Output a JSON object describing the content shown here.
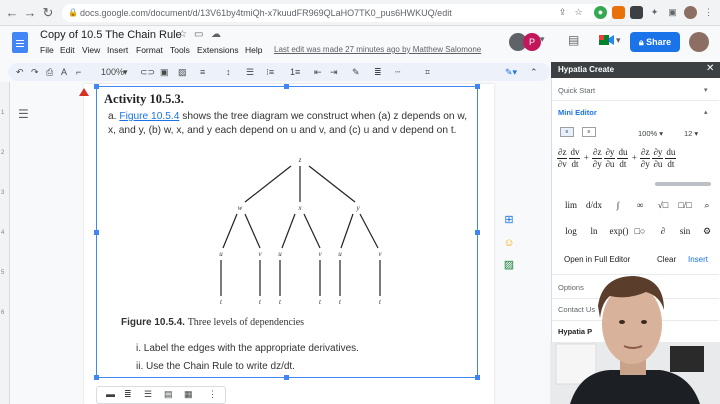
{
  "browser": {
    "url": "docs.google.com/document/d/13V61by4tmiQh-x7kuudFR969QLaHO7TK0_pus6HWKUQ/edit"
  },
  "docs": {
    "title": "Copy of 10.5 The Chain Rule",
    "menu": [
      "File",
      "Edit",
      "View",
      "Insert",
      "Format",
      "Tools",
      "Extensions",
      "Help"
    ],
    "last_edit": "Last edit was made 27 minutes ago by Matthew Salomone",
    "share_label": "Share",
    "avatar_letter": "P"
  },
  "toolbar": {
    "zoom": "100%"
  },
  "ruler": [
    "1",
    "2",
    "3",
    "4",
    "5",
    "6"
  ],
  "document": {
    "activity_title": "Activity 10.5.3.",
    "item_a_label": "a.",
    "figure_link": "Figure 10.5.4",
    "item_a_rest": "shows the tree diagram we construct when (a) z depends on w, x, and y, (b) w, x, and y each depend on u and v, and (c) u and v depend on t.",
    "tree": {
      "root": "z",
      "level1": [
        "w",
        "x",
        "y"
      ],
      "level2": [
        "u",
        "v",
        "u",
        "v",
        "u",
        "v"
      ],
      "level3": [
        "t",
        "t",
        "t",
        "t",
        "t",
        "t"
      ]
    },
    "caption_label": "Figure 10.5.4.",
    "caption_text": "Three levels of dependencies",
    "item_i": "i. Label the edges with the appropriate derivatives.",
    "item_ii": "ii. Use the Chain Rule to write dz/dt."
  },
  "panel": {
    "title": "Hypatia Create",
    "quick_start": "Quick Start",
    "mini_editor": "Mini Editor",
    "zoom": "100%",
    "font_size": "12",
    "symbols_row1": [
      "lim",
      "d/dx",
      "∫",
      "∞",
      "√□",
      "□/□",
      "⌕"
    ],
    "symbols_row2": [
      "log",
      "ln",
      "exp()",
      "□○",
      "∂",
      "sin",
      "⚙"
    ],
    "open_full": "Open in Full Editor",
    "clear": "Clear",
    "insert": "Insert",
    "options": "Options",
    "contact": "Contact Us",
    "hypatia_p": "Hypatia P"
  }
}
